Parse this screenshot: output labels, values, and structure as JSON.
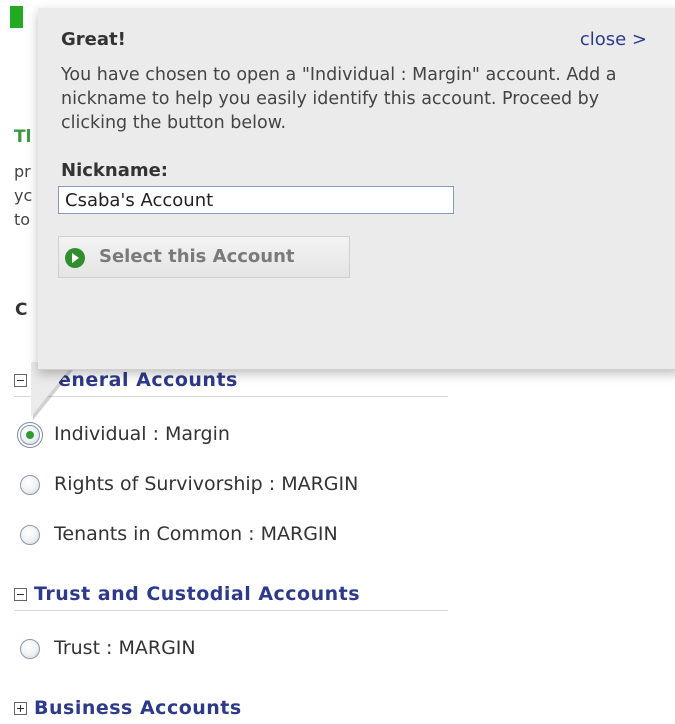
{
  "background_text": {
    "heading_partial": "Tl",
    "lines_partial": [
      "pr",
      "yc",
      "to"
    ],
    "c_partial": "C"
  },
  "callout": {
    "title": "Great!",
    "close_label": "close >",
    "body": "You have chosen to open a \"Individual : Margin\" account. Add a nickname to help you easily identify this account. Proceed by clicking the button below.",
    "nickname_label": "Nickname:",
    "nickname_value": "Csaba's Account",
    "select_button_label": "Select this Account"
  },
  "sections": {
    "general": {
      "title": "eneral Accounts",
      "options": [
        "Individual : Margin",
        "Rights of Survivorship : MARGIN",
        "Tenants in Common : MARGIN"
      ],
      "selected": "Individual : Margin"
    },
    "trust": {
      "title": "Trust and Custodial Accounts",
      "options": [
        "Trust : MARGIN"
      ]
    },
    "business": {
      "title": "Business Accounts",
      "collapsed": true
    }
  },
  "colors": {
    "accent_green": "#2f9a2f",
    "section_title": "#2d3a8c",
    "callout_bg": "#ebebeb"
  }
}
